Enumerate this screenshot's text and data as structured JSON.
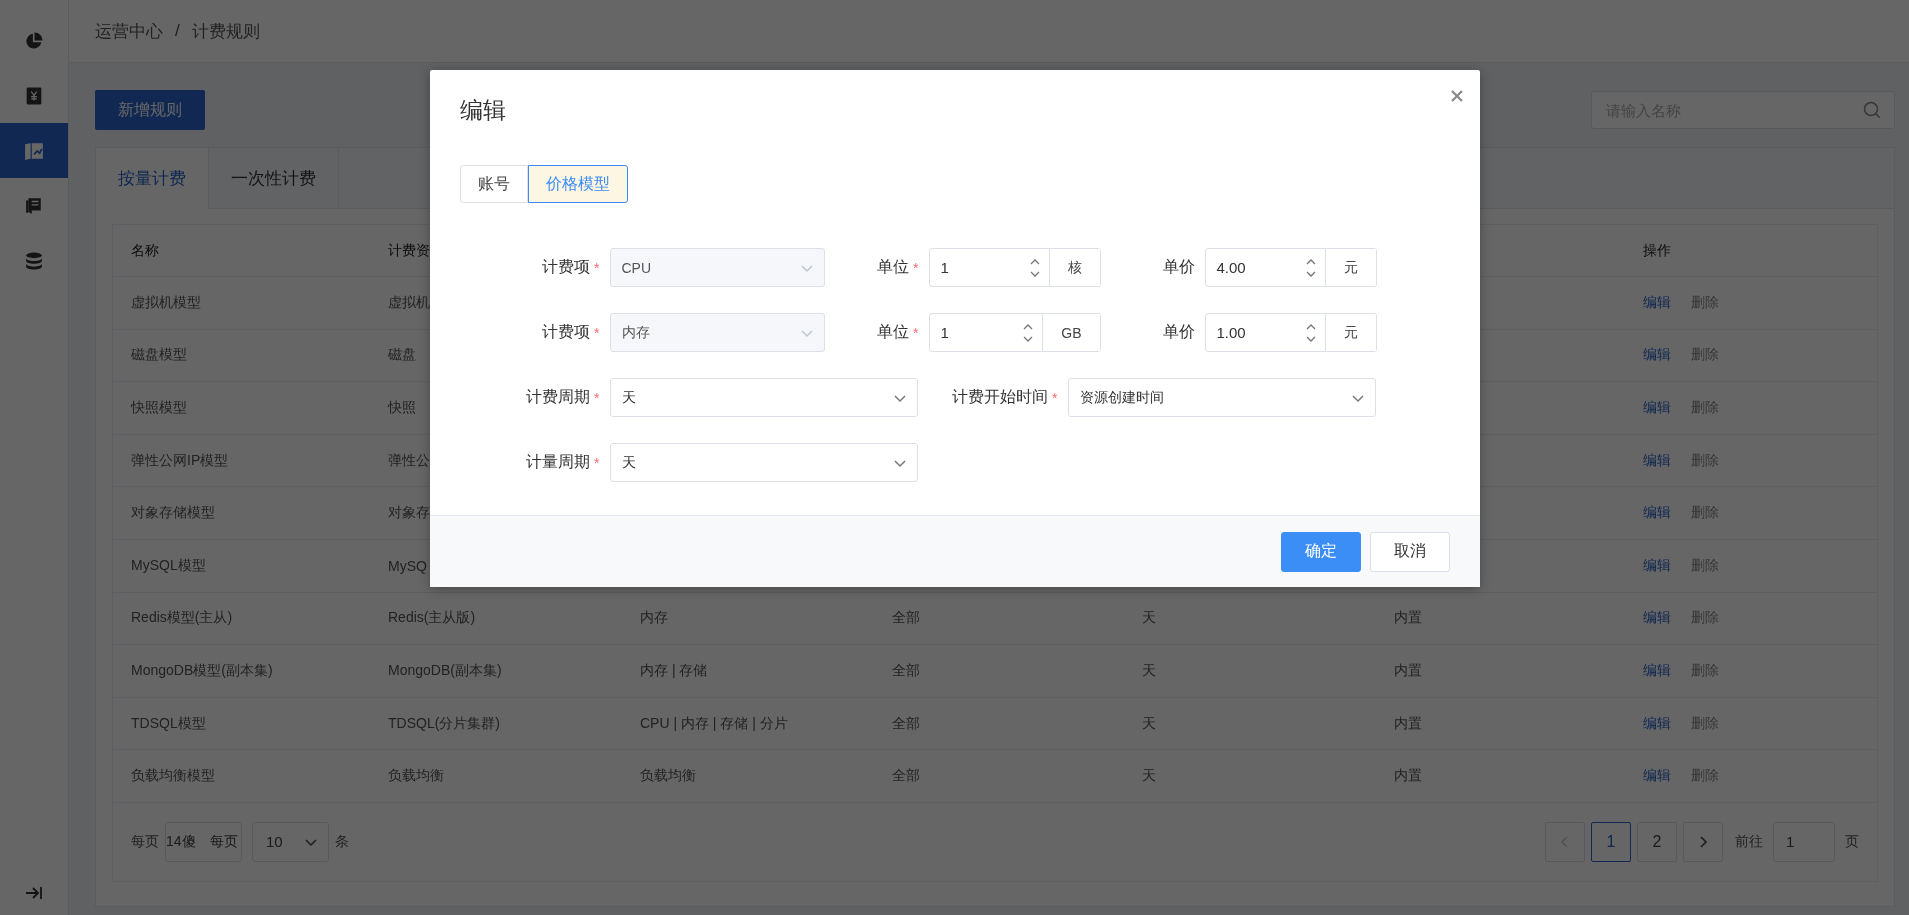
{
  "sidebar": {
    "items": [
      {
        "kind": "pie",
        "selected": false
      },
      {
        "kind": "yen",
        "selected": false
      },
      {
        "kind": "chart",
        "selected": true
      },
      {
        "kind": "book",
        "selected": false
      },
      {
        "kind": "database",
        "selected": false
      }
    ]
  },
  "breadcrumb": [
    "运营中心",
    "/",
    "计费规则"
  ],
  "toolbar": {
    "add_button": "新增规则",
    "search": {
      "placeholder": "请输入名称"
    }
  },
  "tabs": [
    {
      "label": "按量计费",
      "selected": true
    },
    {
      "label": "一次性计费",
      "selected": false
    }
  ],
  "table": {
    "columns": [
      "名称",
      "计费资",
      null,
      null,
      null,
      null,
      "操作"
    ],
    "rows": [
      {
        "cells": [
          "虚拟机模型",
          "虚拟机",
          null,
          null,
          null,
          null
        ],
        "actions": [
          {
            "label": "编辑",
            "disabled": false
          },
          {
            "label": "删除",
            "disabled": true
          }
        ]
      },
      {
        "cells": [
          "磁盘模型",
          "磁盘",
          null,
          null,
          null,
          null
        ],
        "actions": [
          {
            "label": "编辑",
            "disabled": false
          },
          {
            "label": "删除",
            "disabled": true
          }
        ]
      },
      {
        "cells": [
          "快照模型",
          "快照",
          null,
          null,
          null,
          null
        ],
        "actions": [
          {
            "label": "编辑",
            "disabled": false
          },
          {
            "label": "删除",
            "disabled": true
          }
        ]
      },
      {
        "cells": [
          "弹性公网IP模型",
          "弹性公",
          null,
          null,
          null,
          null
        ],
        "actions": [
          {
            "label": "编辑",
            "disabled": false
          },
          {
            "label": "删除",
            "disabled": true
          }
        ]
      },
      {
        "cells": [
          "对象存储模型",
          "对象存",
          null,
          null,
          null,
          null
        ],
        "actions": [
          {
            "label": "编辑",
            "disabled": false
          },
          {
            "label": "删除",
            "disabled": true
          }
        ]
      },
      {
        "cells": [
          "MySQL模型",
          "MySQ",
          null,
          null,
          null,
          null
        ],
        "actions": [
          {
            "label": "编辑",
            "disabled": false
          },
          {
            "label": "删除",
            "disabled": true
          }
        ]
      },
      {
        "cells": [
          "Redis模型(主从)",
          "Redis(主从版)",
          "内存",
          "全部",
          "天",
          "内置"
        ],
        "actions": [
          {
            "label": "编辑",
            "disabled": false
          },
          {
            "label": "删除",
            "disabled": true
          }
        ]
      },
      {
        "cells": [
          "MongoDB模型(副本集)",
          "MongoDB(副本集)",
          "内存 | 存储",
          "全部",
          "天",
          "内置"
        ],
        "actions": [
          {
            "label": "编辑",
            "disabled": false
          },
          {
            "label": "删除",
            "disabled": true
          }
        ]
      },
      {
        "cells": [
          "TDSQL模型",
          "TDSQL(分片集群)",
          "CPU | 内存 | 存储 | 分片",
          "全部",
          "天",
          "内置"
        ],
        "actions": [
          {
            "label": "编辑",
            "disabled": false
          },
          {
            "label": "删除",
            "disabled": true
          }
        ]
      },
      {
        "cells": [
          "负载均衡模型",
          "负载均衡",
          "负载均衡",
          "全部",
          "天",
          "内置"
        ],
        "actions": [
          {
            "label": "编辑",
            "disabled": false
          },
          {
            "label": "删除",
            "disabled": true
          }
        ]
      }
    ]
  },
  "pagination": {
    "total_prefix": "每页",
    "total_box": [
      "14傻",
      "每页"
    ],
    "page_size": "10",
    "page_size_suffix": "条",
    "prev_disabled": true,
    "next_disabled": false,
    "pages": [
      {
        "label": "1",
        "selected": true
      },
      {
        "label": "2",
        "selected": false
      }
    ],
    "goto_label": "前往",
    "goto_value": "1",
    "goto_suffix": "页"
  },
  "modal": {
    "title": "编辑",
    "segments": [
      {
        "label": "账号",
        "selected": false
      },
      {
        "label": "价格模型",
        "selected": true
      }
    ],
    "rows": [
      {
        "fields": [
          {
            "kind": "select",
            "label": "计费项",
            "required_mark": "*",
            "value": "CPU",
            "disabled": true
          },
          {
            "kind": "number",
            "label": "单位",
            "required_mark": "*",
            "value": "1",
            "unit": "核"
          },
          {
            "kind": "number",
            "label": "单价",
            "value": "4.00",
            "unit": "元"
          }
        ]
      },
      {
        "fields": [
          {
            "kind": "select",
            "label": "计费项",
            "required_mark": "*",
            "value": "内存",
            "disabled": true
          },
          {
            "kind": "number",
            "label": "单位",
            "required_mark": "*",
            "value": "1",
            "unit": "GB"
          },
          {
            "kind": "number",
            "label": "单价",
            "value": "1.00",
            "unit": "元"
          }
        ]
      },
      {
        "fields": [
          {
            "kind": "select",
            "label": "计费周期",
            "required_mark": "*",
            "value": "天",
            "disabled": false
          },
          {
            "kind": "select",
            "label": "计费开始时间",
            "required_mark": "*",
            "value": "资源创建时间",
            "disabled": false
          }
        ]
      },
      {
        "fields": [
          {
            "kind": "select",
            "label": "计量周期",
            "required_mark": "*",
            "value": "天",
            "disabled": false
          }
        ]
      }
    ],
    "buttons": [
      {
        "label": "确定",
        "kind": "primary"
      },
      {
        "label": "取消",
        "kind": "default"
      }
    ]
  }
}
